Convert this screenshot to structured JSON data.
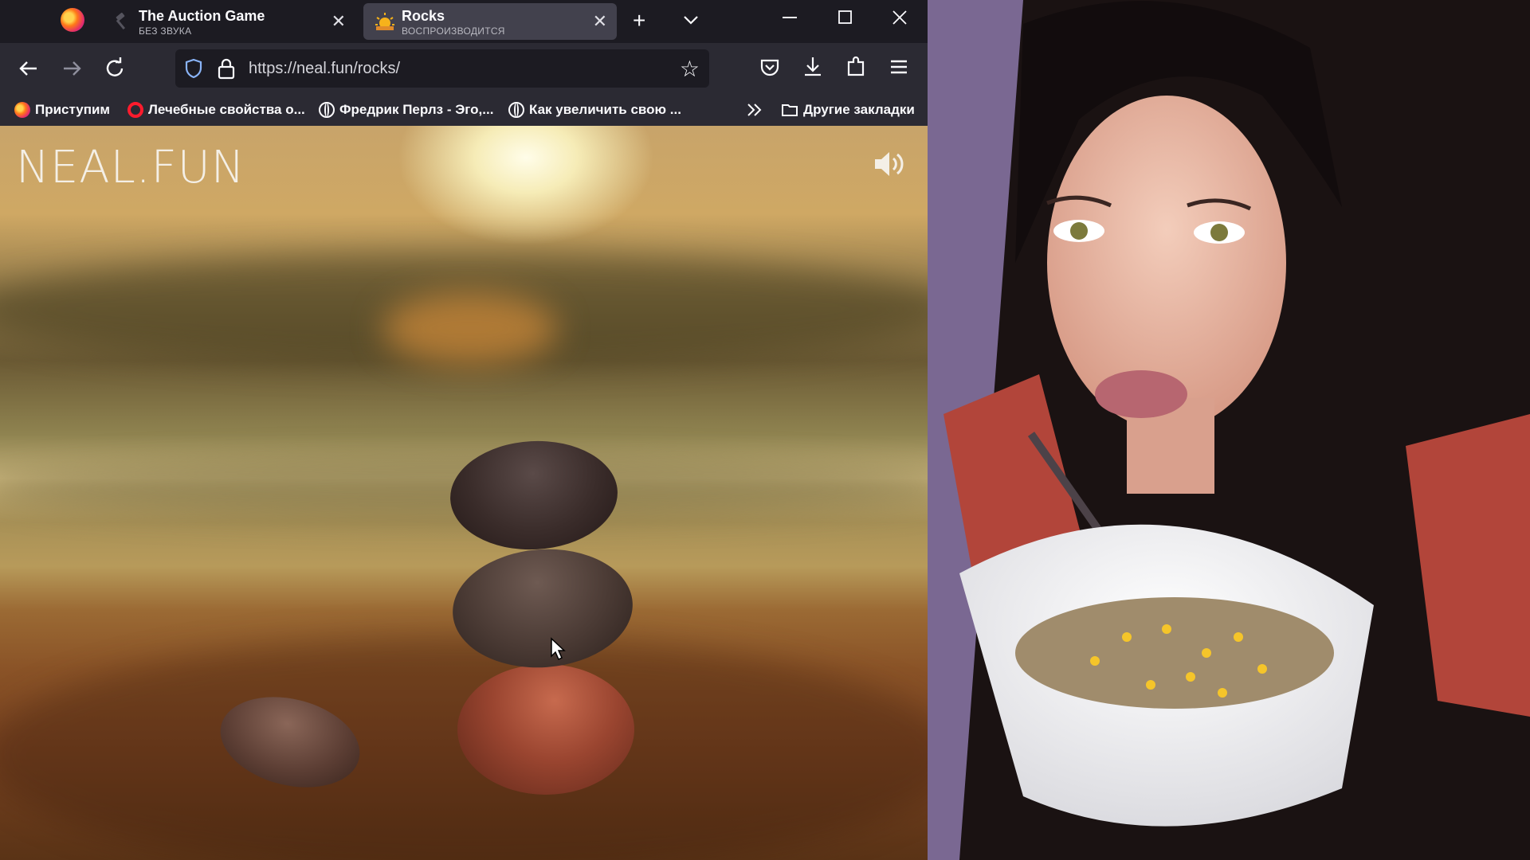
{
  "tabs": [
    {
      "title": "The Auction Game",
      "subtitle": "БЕЗ ЗВУКА",
      "active": false
    },
    {
      "title": "Rocks",
      "subtitle": "ВОСПРОИЗВОДИТСЯ",
      "active": true
    }
  ],
  "address": {
    "url": "https://neal.fun/rocks/"
  },
  "bookmarks": [
    {
      "label": "Приступим",
      "icon": "firefox-icon"
    },
    {
      "label": "Лечебные свойства о...",
      "icon": "opera-icon"
    },
    {
      "label": "Фредрик Перлз - Эго,...",
      "icon": "globe-icon"
    },
    {
      "label": "Как увеличить свою ...",
      "icon": "globe-icon"
    }
  ],
  "other_bookmarks": "Другие закладки",
  "site": {
    "logo": "NEAL.FUN"
  },
  "icons": {
    "new_tab": "plus-icon",
    "tab_list": "chevron-down-icon",
    "minimize": "minimize-icon",
    "maximize": "maximize-icon",
    "close": "close-icon",
    "back": "back-arrow-icon",
    "forward": "forward-arrow-icon",
    "reload": "reload-icon",
    "pocket": "pocket-icon",
    "download": "download-icon",
    "extensions": "puzzle-icon",
    "menu": "hamburger-menu-icon",
    "sound": "speaker-icon"
  },
  "colors": {
    "tab_active_bg": "#42414d",
    "toolbar_bg": "#2b2a33",
    "titlebar_bg": "#1c1b22",
    "urlbar_bg": "#1c1b22"
  }
}
